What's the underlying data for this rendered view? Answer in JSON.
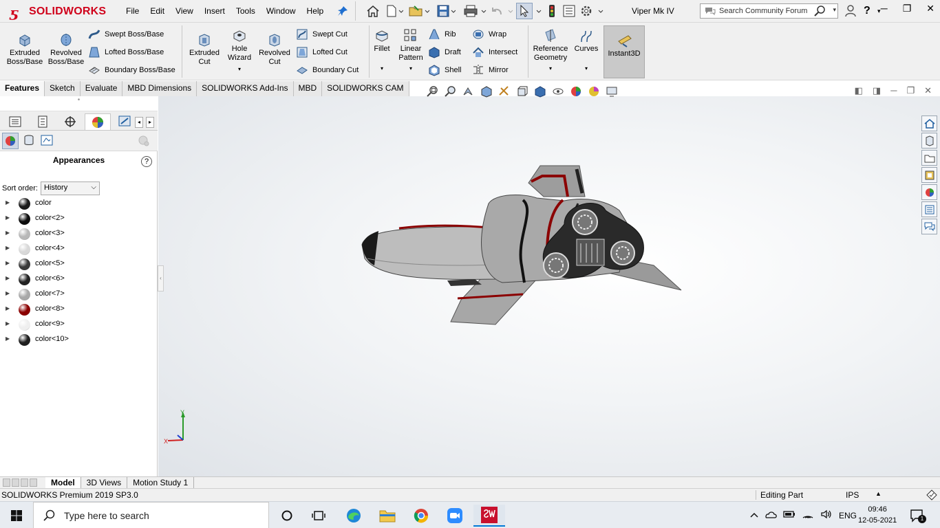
{
  "app": {
    "brand": "SOLIDWORKS",
    "document_title": "Viper Mk IV"
  },
  "menu": [
    "File",
    "Edit",
    "View",
    "Insert",
    "Tools",
    "Window",
    "Help"
  ],
  "search": {
    "placeholder": "Search Community Forum"
  },
  "commands": {
    "extruded_boss": "Extruded Boss/Base",
    "revolved_boss": "Revolved Boss/Base",
    "swept_boss": "Swept Boss/Base",
    "lofted_boss": "Lofted Boss/Base",
    "boundary_boss": "Boundary Boss/Base",
    "extruded_cut": "Extruded Cut",
    "hole_wizard": "Hole Wizard",
    "revolved_cut": "Revolved Cut",
    "swept_cut": "Swept Cut",
    "lofted_cut": "Lofted Cut",
    "boundary_cut": "Boundary Cut",
    "fillet": "Fillet",
    "linear_pattern": "Linear Pattern",
    "rib": "Rib",
    "draft": "Draft",
    "shell": "Shell",
    "wrap": "Wrap",
    "intersect": "Intersect",
    "mirror": "Mirror",
    "reference_geometry": "Reference Geometry",
    "curves": "Curves",
    "instant3d": "Instant3D"
  },
  "command_tabs": [
    "Features",
    "Sketch",
    "Evaluate",
    "MBD Dimensions",
    "SOLIDWORKS Add-Ins",
    "MBD",
    "SOLIDWORKS CAM"
  ],
  "panel": {
    "title": "Appearances",
    "sort_label": "Sort order:",
    "sort_value": "History",
    "items": [
      {
        "label": "color",
        "color": "#1a1a1a"
      },
      {
        "label": "color<2>",
        "color": "#0d0d0d"
      },
      {
        "label": "color<3>",
        "color": "#b8b8b8"
      },
      {
        "label": "color<4>",
        "color": "#d8d8d8"
      },
      {
        "label": "color<5>",
        "color": "#3a3a3a"
      },
      {
        "label": "color<6>",
        "color": "#222222"
      },
      {
        "label": "color<7>",
        "color": "#a8a8a8"
      },
      {
        "label": "color<8>",
        "color": "#8b0000"
      },
      {
        "label": "color<9>",
        "color": "#efefef"
      },
      {
        "label": "color<10>",
        "color": "#1f1f1f"
      }
    ]
  },
  "triad": {
    "x": "X",
    "y": "Y"
  },
  "bottom_tabs": [
    "Model",
    "3D Views",
    "Motion Study 1"
  ],
  "status": {
    "product": "SOLIDWORKS Premium 2019 SP3.0",
    "mode": "Editing Part",
    "units": "IPS"
  },
  "taskbar": {
    "search_placeholder": "Type here to search",
    "language": "ENG",
    "time": "09:46",
    "date": "12-05-2021",
    "notification_count": "1"
  }
}
